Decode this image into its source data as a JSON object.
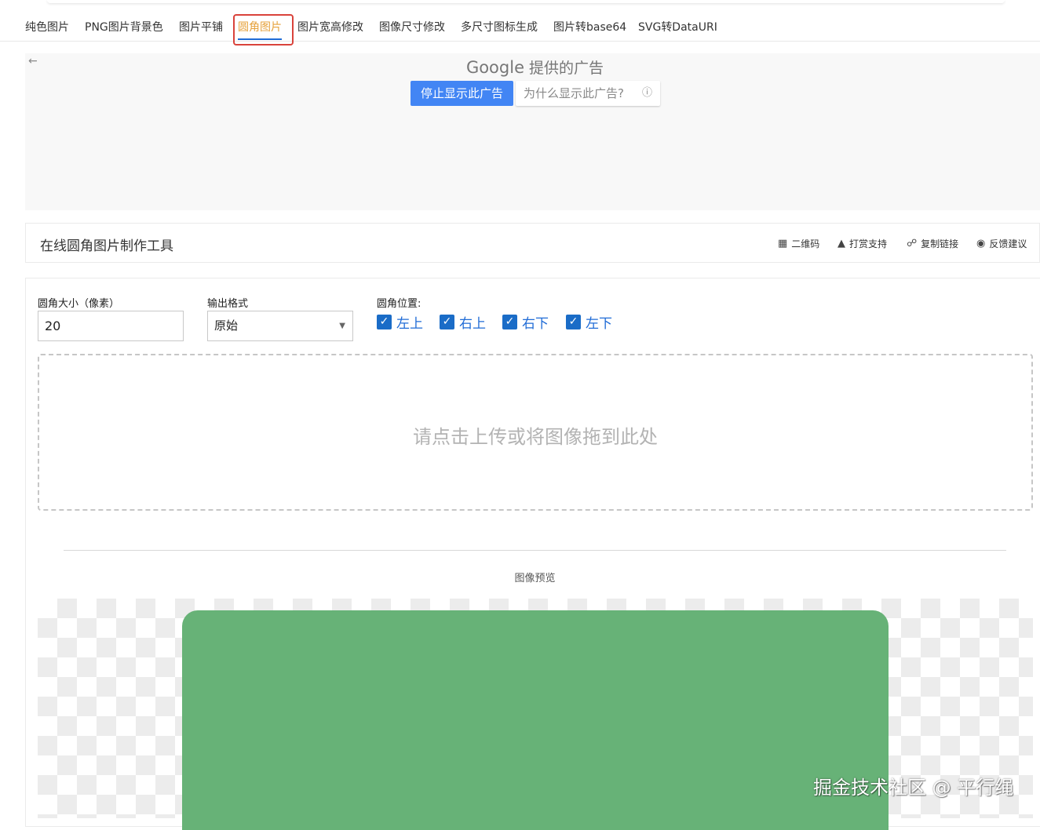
{
  "nav": {
    "tabs": [
      {
        "label": "纯色图片"
      },
      {
        "label": "PNG图片背景色"
      },
      {
        "label": "图片平铺"
      },
      {
        "label": "圆角图片"
      },
      {
        "label": "图片宽高修改"
      },
      {
        "label": "图像尺寸修改"
      },
      {
        "label": "多尺寸图标生成"
      },
      {
        "label": "图片转base64"
      },
      {
        "label": "SVG转DataURI"
      }
    ],
    "active_index": 3,
    "active_color": "#e6a23c",
    "highlight_color": "#d9433b"
  },
  "ad": {
    "back_icon": "arrow-left-icon",
    "google_label": "Google",
    "provided_label": "提供的广告",
    "stop_button": "停止显示此广告",
    "why_button": "为什么显示此广告?",
    "info_icon": "info-icon",
    "button_color": "#4285f4"
  },
  "toolbar": {
    "title": "在线圆角图片制作工具",
    "actions": [
      {
        "icon": "qrcode-icon",
        "label": "二维码"
      },
      {
        "icon": "thumbs-up-icon",
        "label": "打赏支持"
      },
      {
        "icon": "share-icon",
        "label": "复制链接"
      },
      {
        "icon": "feedback-icon",
        "label": "反馈建议"
      }
    ]
  },
  "form": {
    "radius_label": "圆角大小（像素）",
    "radius_value": "20",
    "format_label": "输出格式",
    "format_value": "原始",
    "position_label": "圆角位置:",
    "positions": [
      {
        "label": "左上",
        "checked": true
      },
      {
        "label": "右上",
        "checked": true
      },
      {
        "label": "右下",
        "checked": true
      },
      {
        "label": "左下",
        "checked": true
      }
    ]
  },
  "dropzone": {
    "text": "请点击上传或将图像拖到此处"
  },
  "preview": {
    "label": "图像预览",
    "image_color": "#67b277"
  },
  "watermark": {
    "text": "掘金技术社区 @ 平行绳"
  }
}
